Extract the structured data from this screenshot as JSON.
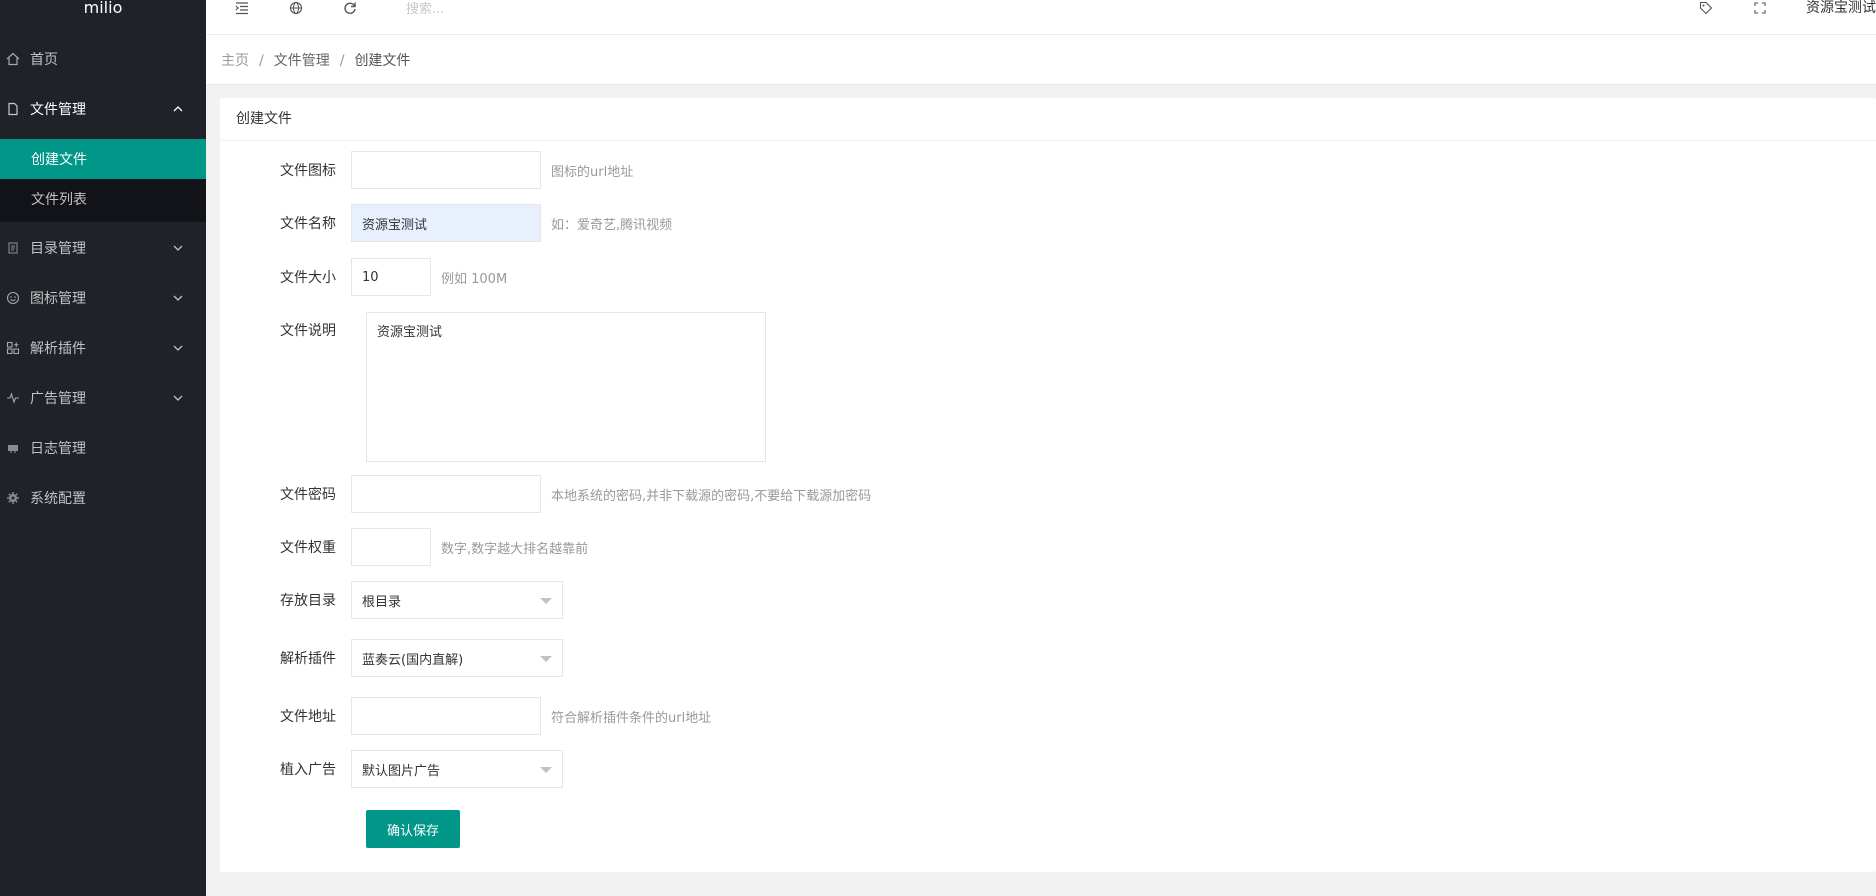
{
  "sidebar": {
    "logo": "milio",
    "items": [
      {
        "label": "首页",
        "icon": "home-icon"
      },
      {
        "label": "文件管理",
        "icon": "file-icon"
      },
      {
        "label": "目录管理",
        "icon": "document-icon"
      },
      {
        "label": "图标管理",
        "icon": "smile-icon"
      },
      {
        "label": "解析插件",
        "icon": "app-icon"
      },
      {
        "label": "广告管理",
        "icon": "pulse-icon"
      },
      {
        "label": "日志管理",
        "icon": "log-icon"
      },
      {
        "label": "系统配置",
        "icon": "gear-icon"
      }
    ],
    "sub_items": [
      {
        "label": "创建文件",
        "active": true
      },
      {
        "label": "文件列表",
        "active": false
      }
    ]
  },
  "header": {
    "search_placeholder": "搜索...",
    "username": "资源宝测试"
  },
  "breadcrumb": [
    "主页",
    "文件管理",
    "创建文件"
  ],
  "card": {
    "title": "创建文件"
  },
  "form": {
    "icon": {
      "label": "文件图标",
      "value": "",
      "tip": "图标的url地址"
    },
    "name": {
      "label": "文件名称",
      "value": "资源宝测试",
      "tip": "如：爱奇艺,腾讯视频"
    },
    "size": {
      "label": "文件大小",
      "value": "10",
      "tip": "例如 100M"
    },
    "desc": {
      "label": "文件说明",
      "value": "资源宝测试"
    },
    "password": {
      "label": "文件密码",
      "value": "",
      "tip": "本地系统的密码,并非下载源的密码,不要给下载源加密码"
    },
    "weight": {
      "label": "文件权重",
      "value": "",
      "tip": "数字,数字越大排名越靠前"
    },
    "dir": {
      "label": "存放目录",
      "selected": "根目录"
    },
    "plugin": {
      "label": "解析插件",
      "selected": "蓝奏云(国内直解)"
    },
    "url": {
      "label": "文件地址",
      "value": "",
      "tip": "符合解析插件条件的url地址"
    },
    "ad": {
      "label": "植入广告",
      "selected": "默认图片广告"
    },
    "submit_label": "确认保存"
  },
  "colors": {
    "sidebar_bg": "#20222a",
    "accent": "#009688"
  }
}
